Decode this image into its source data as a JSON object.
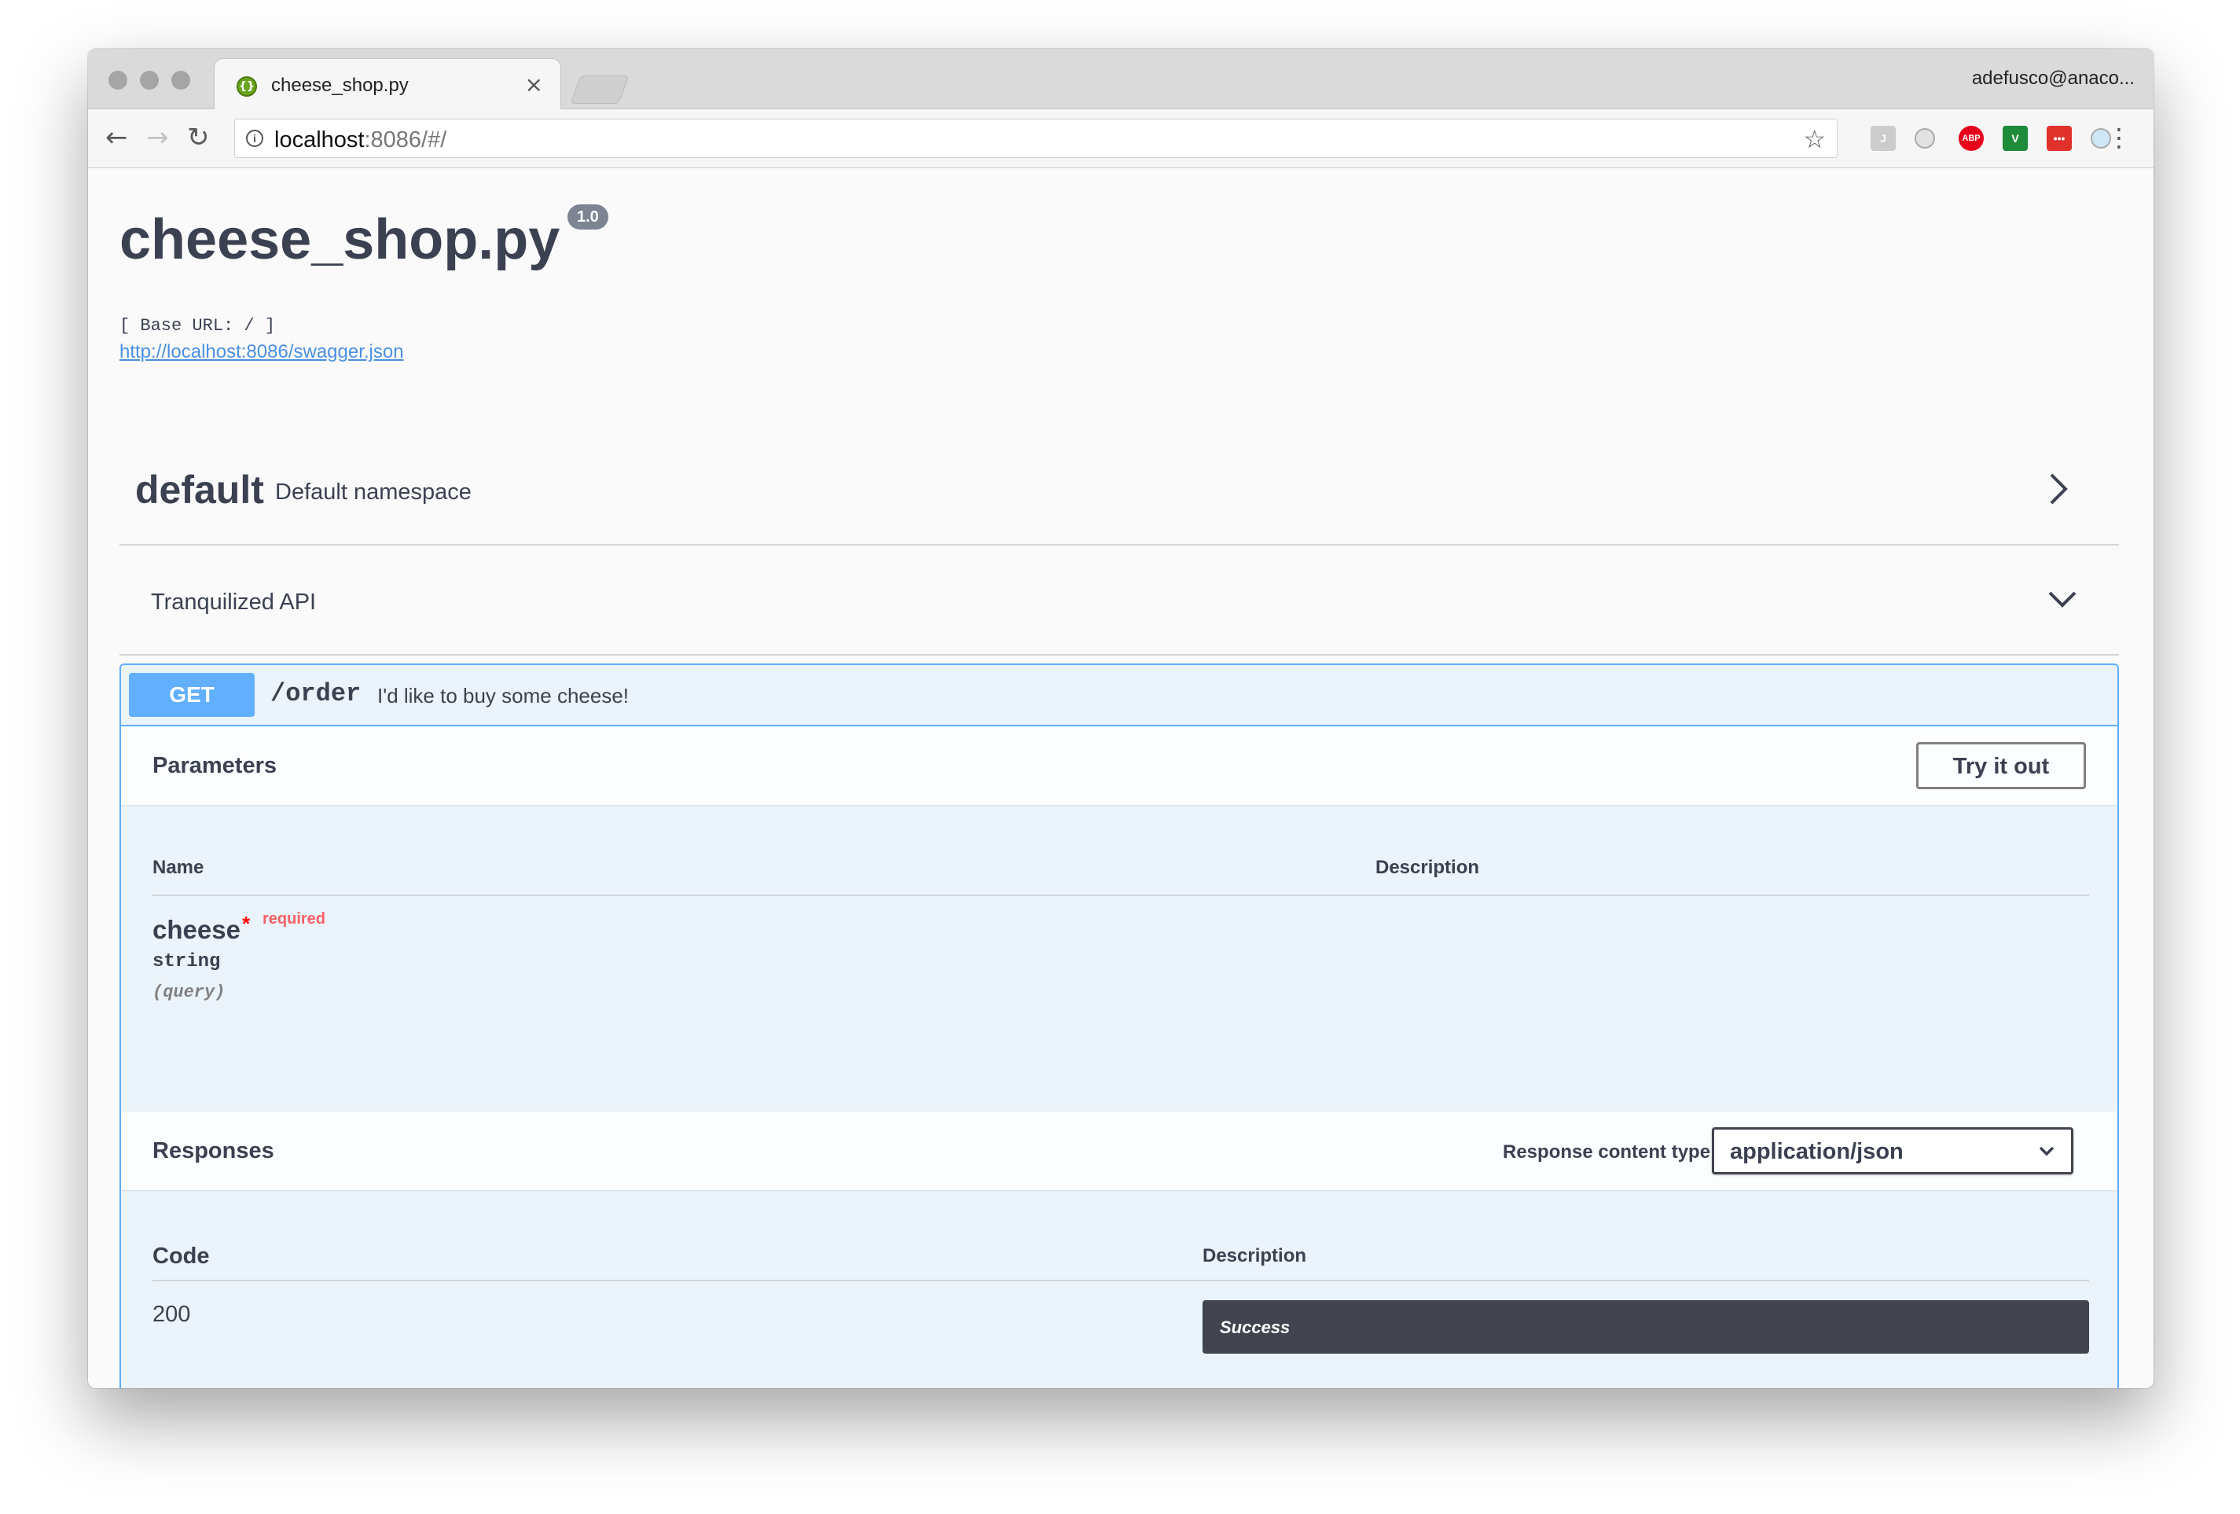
{
  "browser": {
    "tab_title": "cheese_shop.py",
    "tab_close": "×",
    "profile": "adefusco@anaco...",
    "url_host": "localhost",
    "url_rest": ":8086/#/"
  },
  "extensions": [
    {
      "icon": "j-extension-icon",
      "label": "J",
      "color": "#cccccc"
    },
    {
      "icon": "circle-extension-icon",
      "label": "",
      "color": "#e2e2e2"
    },
    {
      "icon": "adblock-plus-icon",
      "label": "ABP",
      "color": "#e8001c"
    },
    {
      "icon": "v-extension-icon",
      "label": "V",
      "color": "#1e8a3a"
    },
    {
      "icon": "dots-extension-icon",
      "label": "•••",
      "color": "#e0312b"
    },
    {
      "icon": "sync-extension-icon",
      "label": "",
      "color": "#cfe6f6"
    }
  ],
  "api": {
    "title": "cheese_shop.py",
    "version": "1.0",
    "base_url": "[ Base URL: / ]",
    "spec_link": "http://localhost:8086/swagger.json"
  },
  "namespace": {
    "name": "default",
    "description": "Default namespace"
  },
  "tag": {
    "name": "Tranquilized API"
  },
  "operation": {
    "method": "GET",
    "path": "/order",
    "summary": "I'd like to buy some cheese!",
    "method_color": "#61affe",
    "parameters": {
      "title": "Parameters",
      "try_label": "Try it out",
      "col_name": "Name",
      "col_description": "Description",
      "items": [
        {
          "name": "cheese",
          "required_star": "*",
          "required_label": "required",
          "type": "string",
          "in": "(query)"
        }
      ]
    },
    "responses": {
      "title": "Responses",
      "content_type_label": "Response content type",
      "content_type_value": "application/json",
      "col_code": "Code",
      "col_description": "Description",
      "items": [
        {
          "code": "200",
          "description": "Success"
        }
      ]
    }
  }
}
